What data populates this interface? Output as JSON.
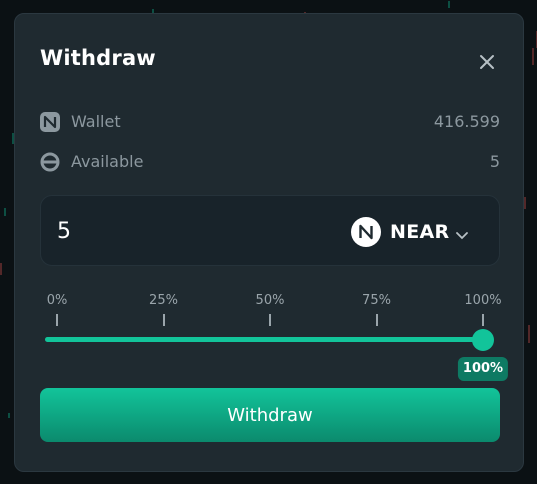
{
  "modal": {
    "title": "Withdraw",
    "close_icon": "close-icon"
  },
  "wallet": {
    "label": "Wallet",
    "value": "416.599",
    "icon": "near-icon"
  },
  "available": {
    "label": "Available",
    "value": "5",
    "icon": "ring-icon"
  },
  "amount": {
    "value": "5"
  },
  "token": {
    "symbol": "NEAR",
    "icon": "near-logo-icon",
    "chevron": "chevron-down-icon"
  },
  "slider": {
    "ticks": [
      "0%",
      "25%",
      "50%",
      "75%",
      "100%"
    ],
    "value_percent": 100,
    "badge": "100%"
  },
  "submit": {
    "label": "Withdraw"
  },
  "colors": {
    "accent": "#12c49a",
    "modal_bg": "#1f2a30",
    "muted_text": "#8c989f"
  }
}
